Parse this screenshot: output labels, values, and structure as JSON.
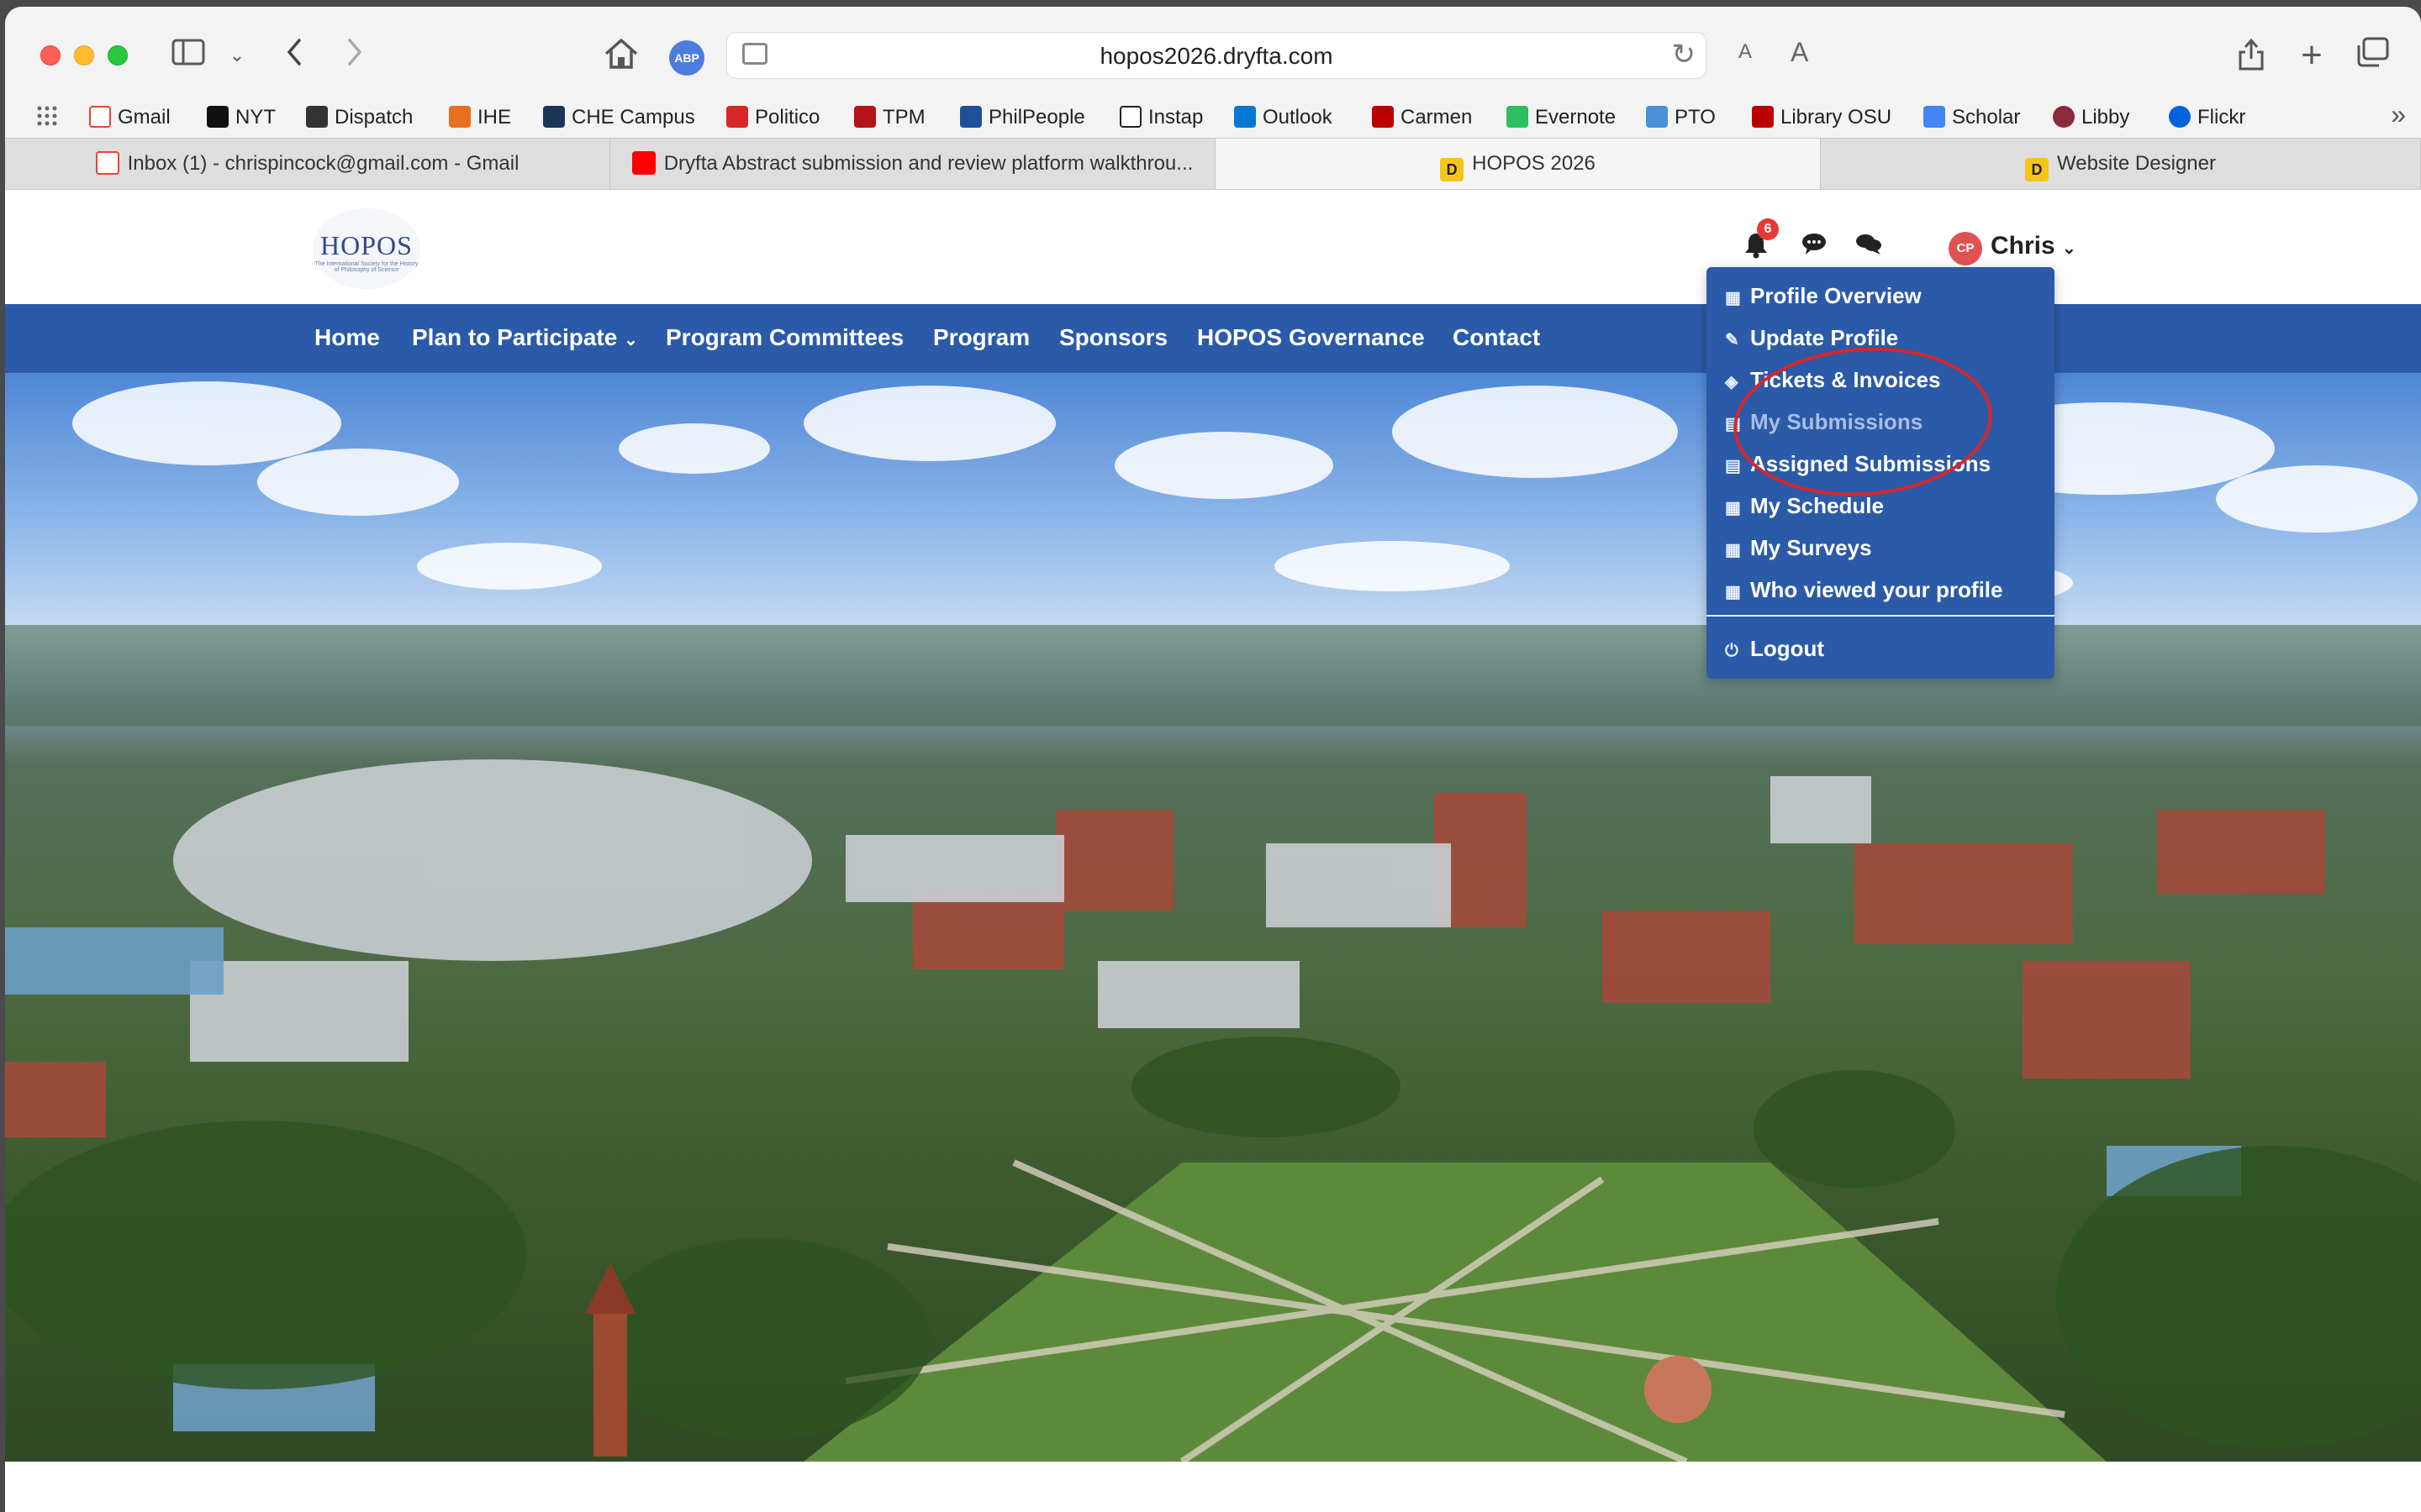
{
  "browser": {
    "url": "hopos2026.dryfta.com",
    "abp_label": "ABP",
    "font_small": "A",
    "font_large": "A"
  },
  "bookmarks": [
    {
      "label": "Gmail",
      "color": "#ea4335"
    },
    {
      "label": "NYT",
      "color": "#111111"
    },
    {
      "label": "Dispatch",
      "color": "#333333"
    },
    {
      "label": "IHE",
      "color": "#e76f1e"
    },
    {
      "label": "CHE Campus",
      "color": "#1d3557"
    },
    {
      "label": "Politico",
      "color": "#d62828"
    },
    {
      "label": "TPM",
      "color": "#b5121b"
    },
    {
      "label": "PhilPeople",
      "color": "#1f4e9a"
    },
    {
      "label": "Instap",
      "color": "#222222"
    },
    {
      "label": "Outlook",
      "color": "#0078d4"
    },
    {
      "label": "Carmen",
      "color": "#bb0000"
    },
    {
      "label": "Evernote",
      "color": "#2dbe60"
    },
    {
      "label": "PTO",
      "color": "#4a90d9"
    },
    {
      "label": "Library OSU",
      "color": "#bb0000"
    },
    {
      "label": "Scholar",
      "color": "#4285f4"
    },
    {
      "label": "Libby",
      "color": "#8a2a3a"
    },
    {
      "label": "Flickr",
      "color": "#0063dc"
    }
  ],
  "tabs": [
    {
      "label": "Inbox (1) - chrispincock@gmail.com - Gmail",
      "icon": "gmail-icon"
    },
    {
      "label": "Dryfta Abstract submission and review platform walkthrou...",
      "icon": "youtube-icon"
    },
    {
      "label": "HOPOS 2026",
      "icon": "dryfta-icon"
    },
    {
      "label": "Website Designer",
      "icon": "dryfta-icon"
    }
  ],
  "site": {
    "logo_text": "HOPOS",
    "logo_subtext": "The International Society for the History of Philosophy of Science",
    "notification_count": "6",
    "avatar_initials": "CP",
    "user_name": "Chris",
    "nav": [
      "Home",
      "Plan to Participate",
      "Program Committees",
      "Program",
      "Sponsors",
      "HOPOS Governance",
      "Contact"
    ]
  },
  "dropdown": {
    "items": [
      "Profile Overview",
      "Update Profile",
      "Tickets & Invoices",
      "My Submissions",
      "Assigned Submissions",
      "My Schedule",
      "My Surveys",
      "Who viewed your profile"
    ],
    "logout": "Logout"
  },
  "colors": {
    "nav_bg": "#2b5aa8",
    "annotation": "#d7262a",
    "badge": "#e53935"
  }
}
